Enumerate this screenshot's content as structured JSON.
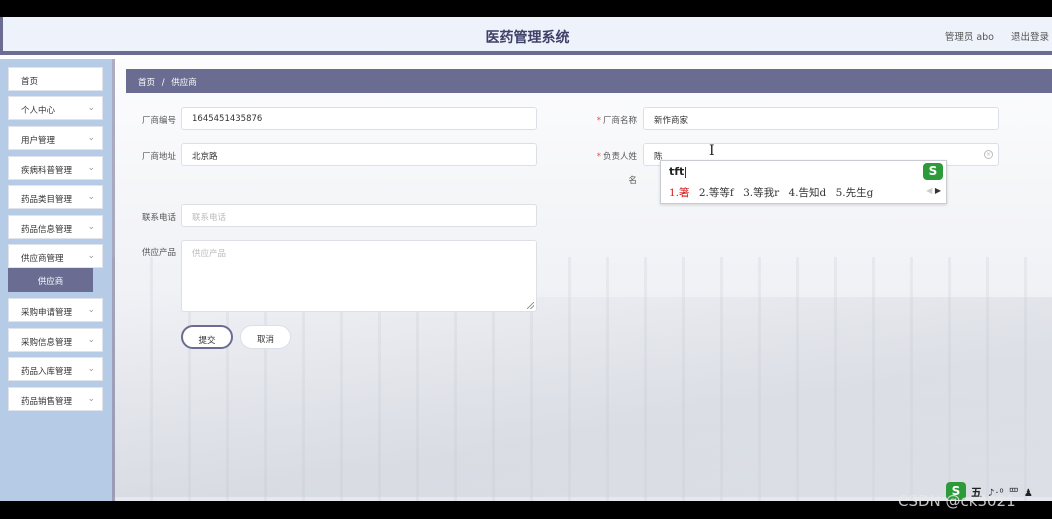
{
  "header": {
    "app_title": "医药管理系统",
    "user_info": "管理员 abo",
    "logout_label": "退出登录"
  },
  "sidebar": {
    "items": [
      {
        "label": "首页",
        "has_chevron": false
      },
      {
        "label": "个人中心",
        "has_chevron": true
      },
      {
        "label": "用户管理",
        "has_chevron": true
      },
      {
        "label": "疾病科普管理",
        "has_chevron": true
      },
      {
        "label": "药品类目管理",
        "has_chevron": true
      },
      {
        "label": "药品信息管理",
        "has_chevron": true
      },
      {
        "label": "供应商管理",
        "has_chevron": true
      },
      {
        "label": "采购申请管理",
        "has_chevron": true
      },
      {
        "label": "采购信息管理",
        "has_chevron": true
      },
      {
        "label": "药品入库管理",
        "has_chevron": true
      },
      {
        "label": "药品销售管理",
        "has_chevron": true
      }
    ],
    "active_sub_item": "供应商",
    "chevron_glyph": "⌄"
  },
  "breadcrumb": {
    "home": "首页",
    "separator": "/",
    "current": "供应商"
  },
  "form": {
    "vendor_code": {
      "label": "厂商编号",
      "value": "1645451435876"
    },
    "vendor_name": {
      "label": "厂商名称",
      "value": "新作商家",
      "required": true
    },
    "vendor_address": {
      "label": "厂商地址",
      "value": "北京路"
    },
    "contact_person": {
      "label": "负责人姓",
      "label_wrap": "名",
      "value": "陈",
      "required": true
    },
    "phone": {
      "label": "联系电话",
      "placeholder": "联系电话"
    },
    "products": {
      "label": "供应产品",
      "placeholder": "供应产品"
    },
    "required_mark": "*",
    "submit_label": "提交",
    "cancel_label": "取消"
  },
  "ime_popup": {
    "composition": "tft",
    "candidates": [
      "1.箸",
      "2.等等f",
      "3.等我r",
      "4.告知d",
      "5.先生g"
    ],
    "logo": "S",
    "arrow_prev": "◀",
    "arrow_next": "▶"
  },
  "ime_status": {
    "logo": "S",
    "mode": "五",
    "icons": "♪·⁰ 罒 ♟"
  },
  "watermark": "CSDN @ck3021",
  "colors": {
    "accent": "#6a6c92",
    "sidebar_bg": "#b5cbe6",
    "header_bg": "#eef2fb",
    "required": "#e24d4d"
  }
}
